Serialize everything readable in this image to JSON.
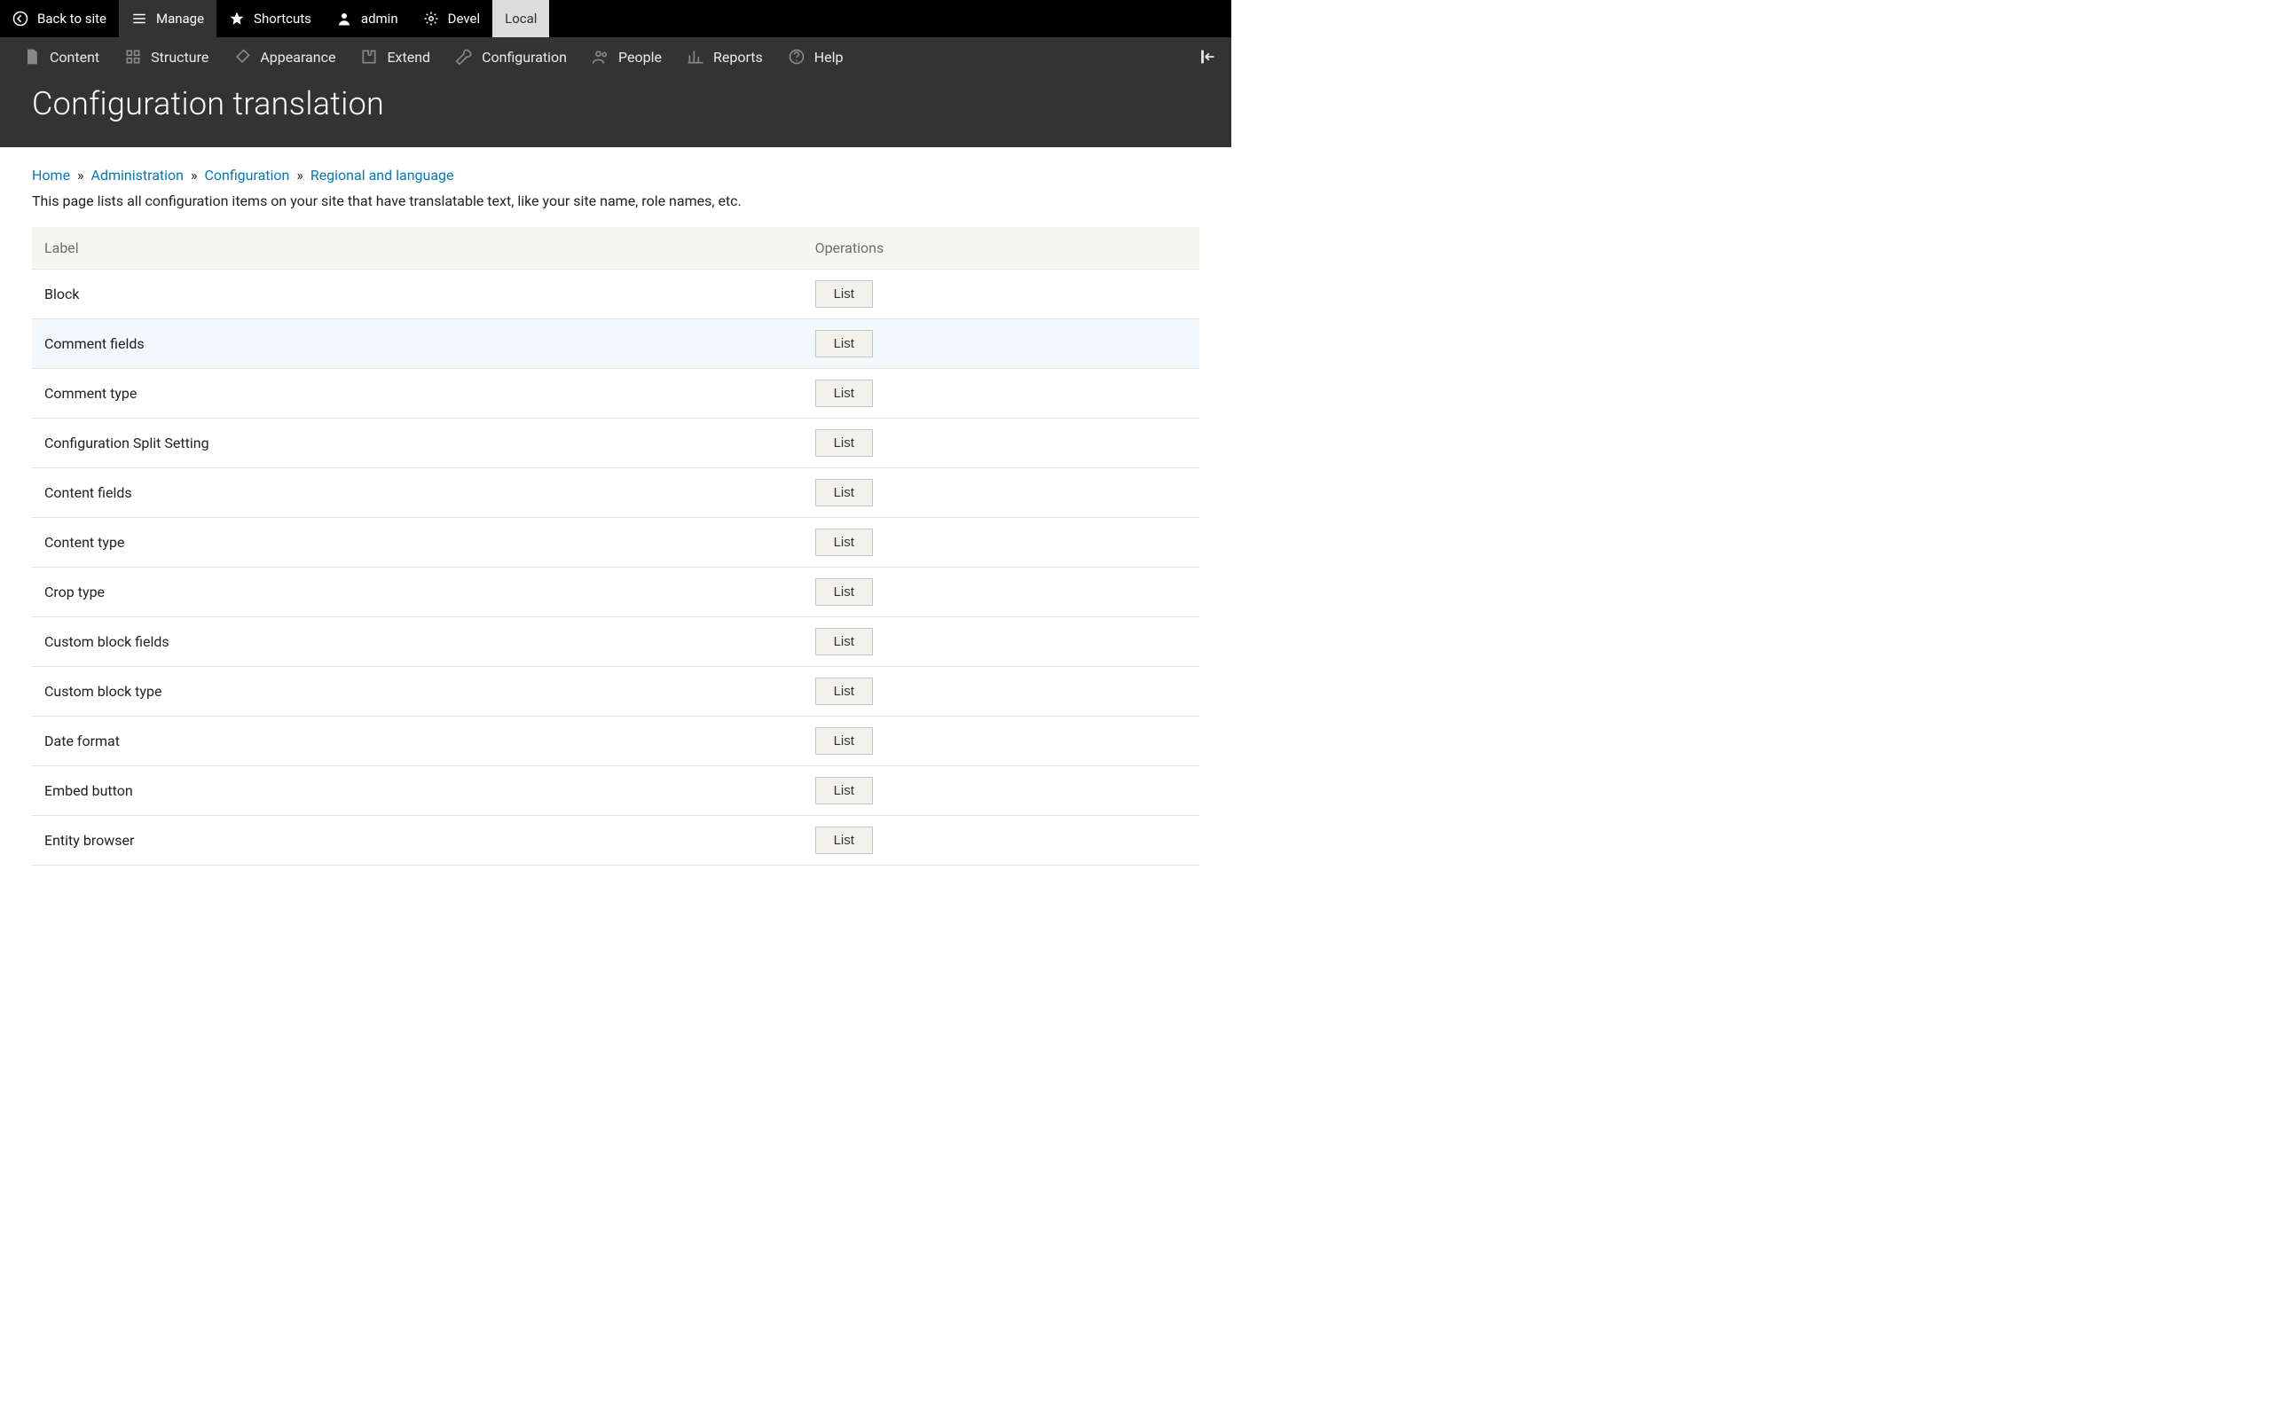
{
  "toolbar": {
    "back": "Back to site",
    "manage": "Manage",
    "shortcuts": "Shortcuts",
    "admin": "admin",
    "devel": "Devel",
    "local": "Local"
  },
  "adminbar": {
    "content": "Content",
    "structure": "Structure",
    "appearance": "Appearance",
    "extend": "Extend",
    "configuration": "Configuration",
    "people": "People",
    "reports": "Reports",
    "help": "Help"
  },
  "page_title": "Configuration translation",
  "breadcrumb": {
    "home": "Home",
    "admin": "Administration",
    "config": "Configuration",
    "regional": "Regional and language",
    "sep": "»"
  },
  "description": "This page lists all configuration items on your site that have translatable text, like your site name, role names, etc.",
  "table": {
    "col_label": "Label",
    "col_ops": "Operations",
    "op_btn": "List",
    "rows": [
      "Block",
      "Comment fields",
      "Comment type",
      "Configuration Split Setting",
      "Content fields",
      "Content type",
      "Crop type",
      "Custom block fields",
      "Custom block type",
      "Date format",
      "Embed button",
      "Entity browser"
    ],
    "hover_index": 1
  }
}
